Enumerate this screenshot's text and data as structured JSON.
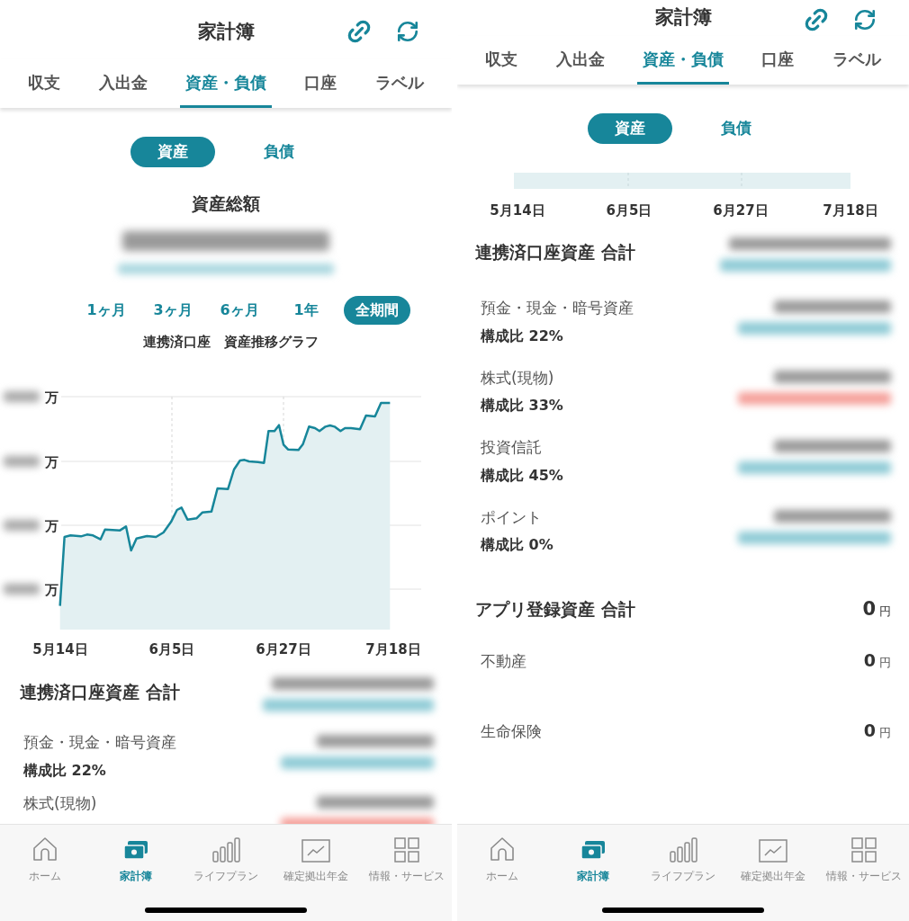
{
  "screens": [
    {
      "title": "家計簿",
      "tabs": [
        {
          "label": "収支",
          "selected": false
        },
        {
          "label": "入出金",
          "selected": false
        },
        {
          "label": "資産・負債",
          "selected": true
        },
        {
          "label": "口座",
          "selected": false
        },
        {
          "label": "ラベル",
          "selected": false
        }
      ],
      "toggle": [
        {
          "label": "資産",
          "selected": true
        },
        {
          "label": "負債",
          "selected": false
        }
      ],
      "summary_label": "資産総額",
      "periods": [
        {
          "label": "1ヶ月",
          "selected": false
        },
        {
          "label": "3ヶ月",
          "selected": false
        },
        {
          "label": "6ヶ月",
          "selected": false
        },
        {
          "label": "1年",
          "selected": false
        },
        {
          "label": "全期間",
          "selected": true
        }
      ],
      "chart_title": "連携済口座　資産推移グラフ",
      "chart": {
        "kind": "full",
        "y_units": [
          "万",
          "万",
          "万",
          "万"
        ],
        "x_labels": [
          "5月14日",
          "6月5日",
          "6月27日",
          "7月18日"
        ]
      },
      "linked_total": {
        "label": "連携済口座資産 合計"
      },
      "items": [
        {
          "name": "預金・現金・暗号資産",
          "ratio": "構成比 22%",
          "color": "#8fcbd6"
        },
        {
          "name": "株式(現物)",
          "color": "#f5a19b"
        }
      ],
      "nav": [
        {
          "label": "ホーム",
          "kind": "home",
          "selected": false
        },
        {
          "label": "家計簿",
          "kind": "wallet",
          "selected": true
        },
        {
          "label": "ライフプラン",
          "kind": "bars",
          "selected": false
        },
        {
          "label": "確定拠出年金",
          "kind": "trend",
          "selected": false
        },
        {
          "label": "情報・サービス",
          "kind": "grid",
          "selected": false
        }
      ]
    },
    {
      "title": "家計簿",
      "tabs": [
        {
          "label": "収支",
          "selected": false
        },
        {
          "label": "入出金",
          "selected": false
        },
        {
          "label": "資産・負債",
          "selected": true
        },
        {
          "label": "口座",
          "selected": false
        },
        {
          "label": "ラベル",
          "selected": false
        }
      ],
      "toggle": [
        {
          "label": "資産",
          "selected": true
        },
        {
          "label": "負債",
          "selected": false
        }
      ],
      "chart": {
        "kind": "strip",
        "x_labels": [
          "5月14日",
          "6月5日",
          "6月27日",
          "7月18日"
        ]
      },
      "linked_total": {
        "label": "連携済口座資産 合計"
      },
      "items": [
        {
          "name": "預金・現金・暗号資産",
          "ratio": "構成比 22%",
          "color": "#8fcbd6"
        },
        {
          "name": "株式(現物)",
          "ratio": "構成比 33%",
          "color": "#f5a19b"
        },
        {
          "name": "投資信託",
          "ratio": "構成比 45%",
          "color": "#8fcbd6"
        },
        {
          "name": "ポイント",
          "ratio": "構成比 0%",
          "color": "#8fcbd6"
        }
      ],
      "app_total": {
        "label": "アプリ登録資産 合計",
        "value": "0",
        "unit": "円"
      },
      "app_items": [
        {
          "name": "不動産",
          "value": "0",
          "unit": "円"
        },
        {
          "name": "生命保険",
          "value": "0",
          "unit": "円"
        }
      ],
      "nav": [
        {
          "label": "ホーム",
          "kind": "home",
          "selected": false
        },
        {
          "label": "家計簿",
          "kind": "wallet",
          "selected": true
        },
        {
          "label": "ライフプラン",
          "kind": "bars",
          "selected": false
        },
        {
          "label": "確定拠出年金",
          "kind": "trend",
          "selected": false
        },
        {
          "label": "情報・サービス",
          "kind": "grid",
          "selected": false
        }
      ]
    }
  ]
}
